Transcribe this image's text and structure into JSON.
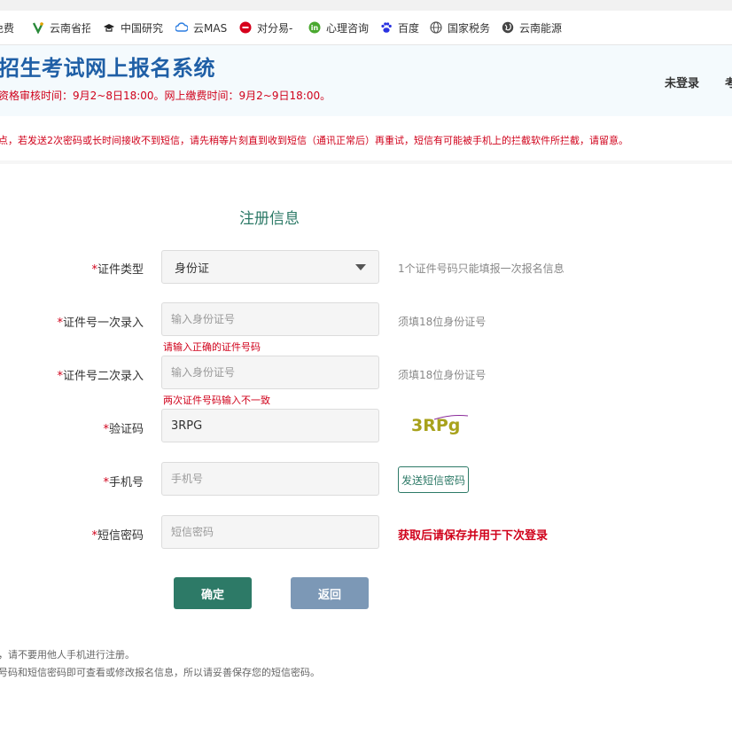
{
  "bookmarks": [
    {
      "label": "免费",
      "icon": "page-icon"
    },
    {
      "label": "云南省招",
      "icon": "leaf-logo-icon"
    },
    {
      "label": "中国研究",
      "icon": "graduation-cap-icon"
    },
    {
      "label": "云MAS",
      "icon": "cloud-icon"
    },
    {
      "label": "对分易-",
      "icon": "red-circle-logo-icon"
    },
    {
      "label": "心理咨询",
      "icon": "green-in-logo-icon"
    },
    {
      "label": "百度",
      "icon": "paw-icon"
    },
    {
      "label": "国家税务",
      "icon": "globe-icon"
    },
    {
      "label": "云南能源",
      "icon": "globe-dark-icon"
    }
  ],
  "header": {
    "title": "招生考试网上报名系统",
    "subtitle": "资格审核时间：9月2~8日18:00。网上缴费时间：9月2~9日18:00。",
    "login_status": "未登录",
    "nav_partial": "考"
  },
  "notice": "点，若发送2次密码或长时间接收不到短信，请先稍等片刻直到收到短信（通讯正常后）再重试，短信有可能被手机上的拦截软件所拦截，请留意。",
  "form": {
    "title": "注册信息",
    "required_mark": "*",
    "id_type": {
      "label": "证件类型",
      "value": "身份证",
      "hint": "1个证件号码只能填报一次报名信息"
    },
    "id_first": {
      "label": "证件号一次录入",
      "placeholder": "输入身份证号",
      "hint": "须填18位身份证号",
      "error": "请输入正确的证件号码"
    },
    "id_second": {
      "label": "证件号二次录入",
      "placeholder": "输入身份证号",
      "hint": "须填18位身份证号",
      "error": "两次证件号码输入不一致"
    },
    "captcha": {
      "label": "验证码",
      "value": "3RPG",
      "image_text": "3RPg"
    },
    "phone": {
      "label": "手机号",
      "placeholder": "手机号",
      "button": "发送短信密码"
    },
    "sms": {
      "label": "短信密码",
      "placeholder": "短信密码",
      "warning": "获取后请保存并用于下次登录"
    }
  },
  "buttons": {
    "confirm": "确定",
    "back": "返回"
  },
  "footer": [
    "，请不要用他人手机进行注册。",
    "号码和短信密码即可查看或修改报名信息，所以请妥善保存您的短信密码。"
  ],
  "colors": {
    "brand_blue": "#1f5fa6",
    "accent_green": "#2d7a67",
    "error_red": "#d0021b",
    "back_button": "#7c98b6"
  }
}
